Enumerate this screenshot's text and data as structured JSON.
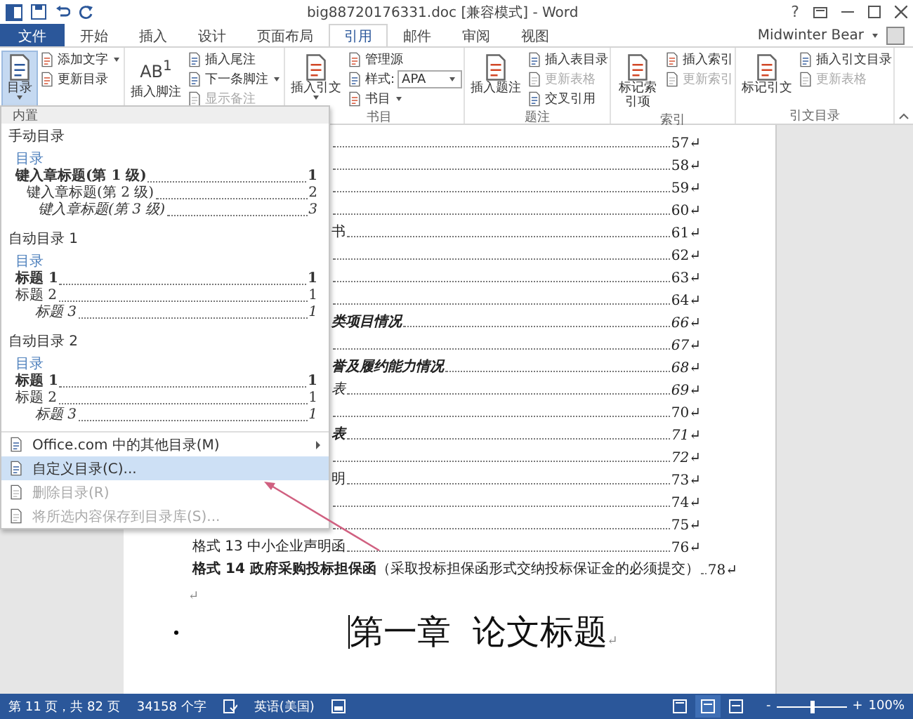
{
  "window": {
    "title": "big88720176331.doc [兼容模式] - Word",
    "help": "?",
    "user": "Midwinter Bear"
  },
  "tabs": [
    {
      "label": "文件",
      "kind": "file",
      "selected": false
    },
    {
      "label": "开始",
      "kind": "tab",
      "selected": false
    },
    {
      "label": "插入",
      "kind": "tab",
      "selected": false
    },
    {
      "label": "设计",
      "kind": "tab",
      "selected": false
    },
    {
      "label": "页面布局",
      "kind": "tab",
      "selected": false
    },
    {
      "label": "引用",
      "kind": "tab",
      "selected": true
    },
    {
      "label": "邮件",
      "kind": "tab",
      "selected": false
    },
    {
      "label": "审阅",
      "kind": "tab",
      "selected": false
    },
    {
      "label": "视图",
      "kind": "tab",
      "selected": false
    }
  ],
  "ribbon": {
    "groups": [
      {
        "big": {
          "label": "目录",
          "caret": true,
          "selected": true
        },
        "small": [
          {
            "kind": "button",
            "label": "添加文字",
            "caret": true,
            "disabled": false
          },
          {
            "kind": "button",
            "label": "更新目录",
            "caret": false,
            "disabled": false
          }
        ]
      },
      {
        "big": {
          "label": "插入脚注",
          "glyph": "AB$^{1}$",
          "caret": false,
          "selected": false
        },
        "small": [
          {
            "kind": "button",
            "label": "插入尾注",
            "caret": false,
            "disabled": false
          },
          {
            "kind": "button",
            "label": "下一条脚注",
            "caret": true,
            "disabled": false
          },
          {
            "kind": "button",
            "label": "显示备注",
            "caret": false,
            "disabled": true
          }
        ]
      },
      {
        "label": "书目",
        "big": {
          "label": "插入引文",
          "caret": true,
          "selected": false
        },
        "small": [
          {
            "kind": "button",
            "label": "管理源",
            "caret": false,
            "disabled": false
          },
          {
            "kind": "dropdown",
            "label": "样式:",
            "value": "APA",
            "caret": true
          },
          {
            "kind": "button",
            "label": "书目",
            "caret": true,
            "disabled": false
          }
        ]
      },
      {
        "label": "题注",
        "big": {
          "label": "插入题注",
          "caret": false,
          "selected": false
        },
        "small": [
          {
            "kind": "button",
            "label": "插入表目录",
            "caret": false,
            "disabled": false
          },
          {
            "kind": "button",
            "label": "更新表格",
            "caret": false,
            "disabled": true
          },
          {
            "kind": "button",
            "label": "交叉引用",
            "caret": false,
            "disabled": false
          }
        ]
      },
      {
        "label": "索引",
        "big": {
          "label": "标记索引项",
          "caret": false,
          "selected": false
        },
        "small": [
          {
            "kind": "button",
            "label": "插入索引",
            "caret": false,
            "disabled": false
          },
          {
            "kind": "button",
            "label": "更新索引",
            "caret": false,
            "disabled": true
          }
        ]
      },
      {
        "label": "引文目录",
        "big": {
          "label": "标记引文",
          "caret": false,
          "selected": false
        },
        "small": [
          {
            "kind": "button",
            "label": "插入引文目录",
            "caret": false,
            "disabled": false
          },
          {
            "kind": "button",
            "label": "更新表格",
            "caret": false,
            "disabled": true
          }
        ]
      }
    ]
  },
  "toc_menu": {
    "header": "内置",
    "sections": [
      {
        "title": "手动目录",
        "preview_title": "目录",
        "entries": [
          {
            "text": "键入章标题(第 1 级)",
            "page": "1"
          },
          {
            "text": "键入章标题(第 2 级)",
            "page": "2"
          },
          {
            "text": "键入章标题(第 3 级)",
            "page": "3"
          }
        ]
      },
      {
        "title": "自动目录 1",
        "preview_title": "目录",
        "entries": [
          {
            "text": "标题 1",
            "page": "1"
          },
          {
            "text": "标题 2",
            "page": "1"
          },
          {
            "text": "标题 3",
            "page": "1"
          }
        ]
      },
      {
        "title": "自动目录 2",
        "preview_title": "目录",
        "entries": [
          {
            "text": "标题 1",
            "page": "1"
          },
          {
            "text": "标题 2",
            "page": "1"
          },
          {
            "text": "标题 3",
            "page": "1"
          }
        ]
      }
    ],
    "items": [
      {
        "label": "Office.com 中的其他目录(M)",
        "submenu": true,
        "selected": false,
        "disabled": false
      },
      {
        "label": "自定义目录(C)...",
        "submenu": false,
        "selected": true,
        "disabled": false
      },
      {
        "label": "删除目录(R)",
        "submenu": false,
        "selected": false,
        "disabled": true
      },
      {
        "label": "将所选内容保存到目录库(S)...",
        "submenu": false,
        "selected": false,
        "disabled": true
      }
    ]
  },
  "document": {
    "toc_rows": [
      {
        "text": "",
        "page": "57↵",
        "italic": false
      },
      {
        "text": "",
        "page": "58↵",
        "italic": false
      },
      {
        "text": "",
        "page": "59↵",
        "italic": false
      },
      {
        "text": "",
        "page": "60↵",
        "italic": false
      },
      {
        "text": "书",
        "page": "61↵",
        "bold": false,
        "italic": false
      },
      {
        "text": "",
        "page": "62↵",
        "italic": false
      },
      {
        "text": "",
        "page": "63↵",
        "italic": false
      },
      {
        "text": "",
        "page": "64↵",
        "italic": false
      },
      {
        "text": "类项目情况",
        "page": "66↵",
        "bold": true,
        "italic": true
      },
      {
        "text": "",
        "page": "67↵",
        "italic": true
      },
      {
        "text": "誉及履约能力情况",
        "page": "68↵",
        "bold": true,
        "italic": true
      },
      {
        "text": "表",
        "page": "69↵",
        "bold": false,
        "italic": true
      },
      {
        "text": "",
        "page": "70↵",
        "italic": false
      },
      {
        "text": "表",
        "page": "71↵",
        "bold": true,
        "italic": true
      },
      {
        "text": "",
        "page": "72↵",
        "italic": true
      },
      {
        "text": "明",
        "page": "73↵",
        "bold": false,
        "italic": false
      },
      {
        "text": "",
        "page": "74↵",
        "italic": false
      },
      {
        "text": "",
        "page": "75↵",
        "italic": false
      },
      {
        "text": "格式 13 中小企业声明函",
        "page": "76↵",
        "bold": false,
        "italic": false
      },
      {
        "text": "**格式 14 政府采购投标担保函**（采取投标担保函形式交纳投标保证金的必须提交）",
        "page": "78↵",
        "bold": false,
        "italic": false
      }
    ],
    "empty_mark": "↵",
    "heading": "第一章  论文标题",
    "heading_mark": "↵"
  },
  "status_bar": {
    "page": "第 11 页，共 82 页",
    "words": "34158 个字",
    "language": "英语(美国)",
    "views": [
      {
        "selected": false
      },
      {
        "selected": true
      },
      {
        "selected": false
      }
    ],
    "zoom": {
      "minus": "-",
      "plus": "+",
      "level": 0.5,
      "reading": "100%"
    }
  }
}
